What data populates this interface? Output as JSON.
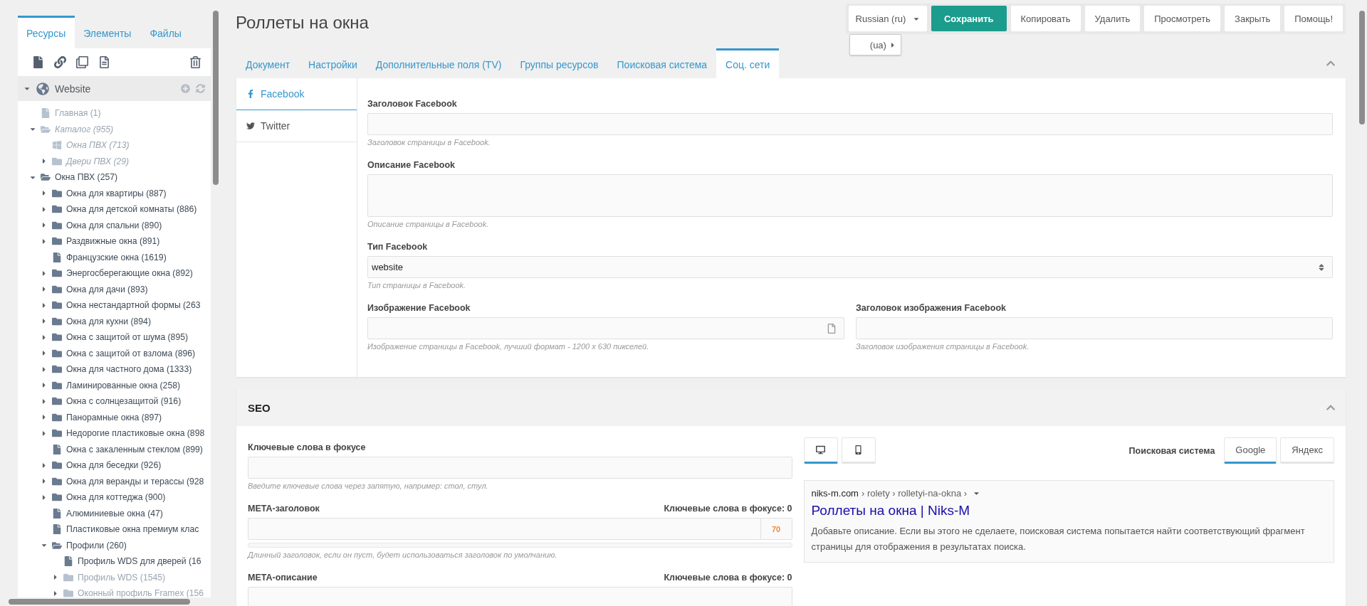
{
  "sidebar": {
    "tabs": [
      {
        "label": "Ресурсы",
        "selected": true
      },
      {
        "label": "Элементы",
        "selected": false
      },
      {
        "label": "Файлы",
        "selected": false
      }
    ],
    "root": {
      "label": "Website",
      "expanded": true
    },
    "tree": [
      {
        "label": "Главная (1)",
        "kind": "file",
        "unpublished": true,
        "hidden": false
      },
      {
        "label": "Каталог (955)",
        "kind": "folder",
        "unpublished": true,
        "hidden": true,
        "expanded": true,
        "children": [
          {
            "label": "Окна ПВХ (713)",
            "kind": "windows",
            "unpublished": true,
            "hidden": true
          },
          {
            "label": "Двери ПВХ (29)",
            "kind": "folder",
            "unpublished": true,
            "hidden": true,
            "expanded": false
          }
        ]
      },
      {
        "label": "Окна ПВХ (257)",
        "kind": "folder",
        "unpublished": false,
        "hidden": false,
        "expanded": true,
        "children": [
          {
            "label": "Окна для квартиры (887)",
            "kind": "folder",
            "expanded": false
          },
          {
            "label": "Окна для детской комнаты (886)",
            "kind": "folder",
            "expanded": false
          },
          {
            "label": "Окна для спальни (890)",
            "kind": "folder",
            "expanded": false
          },
          {
            "label": "Раздвижные окна (891)",
            "kind": "folder",
            "expanded": false
          },
          {
            "label": "Французские окна (1619)",
            "kind": "file"
          },
          {
            "label": "Энергосберегающие окна (892)",
            "kind": "folder",
            "expanded": false
          },
          {
            "label": "Окна для дачи (893)",
            "kind": "folder",
            "expanded": false
          },
          {
            "label": "Окна нестандартной формы (263",
            "kind": "folder",
            "expanded": false
          },
          {
            "label": "Окна для кухни (894)",
            "kind": "folder",
            "expanded": false
          },
          {
            "label": "Окна с защитой от шума (895)",
            "kind": "folder",
            "expanded": false
          },
          {
            "label": "Окна с защитой от взлома (896)",
            "kind": "folder",
            "expanded": false
          },
          {
            "label": "Окна для частного дома (1333)",
            "kind": "folder",
            "expanded": false
          },
          {
            "label": "Ламинированные окна (258)",
            "kind": "folder",
            "expanded": false
          },
          {
            "label": "Окна с солнцезащитой (916)",
            "kind": "folder",
            "expanded": false
          },
          {
            "label": "Панорамные окна (897)",
            "kind": "folder",
            "expanded": false
          },
          {
            "label": "Недорогие пластиковые окна (898",
            "kind": "folder",
            "expanded": false
          },
          {
            "label": "Окна с закаленным стеклом (899)",
            "kind": "file"
          },
          {
            "label": "Окна для беседки (926)",
            "kind": "folder",
            "expanded": false
          },
          {
            "label": "Окна для веранды и терассы (928",
            "kind": "folder",
            "expanded": false
          },
          {
            "label": "Окна для коттеджа (900)",
            "kind": "folder",
            "expanded": false
          },
          {
            "label": "Алюминиевые окна (47)",
            "kind": "file"
          },
          {
            "label": "Пластиковые окна премиум клас",
            "kind": "file"
          },
          {
            "label": "Профили (260)",
            "kind": "folder",
            "expanded": true,
            "children": [
              {
                "label": "Профиль WDS для дверей (16",
                "kind": "file"
              },
              {
                "label": "Профиль WDS (1545)",
                "kind": "folder",
                "unpublished": true,
                "expanded": false
              },
              {
                "label": "Оконный профиль Framex (156",
                "kind": "folder",
                "unpublished": true,
                "expanded": false
              }
            ]
          }
        ]
      }
    ]
  },
  "page": {
    "title": "Роллеты на окна"
  },
  "language": {
    "label": "Russian (ru)",
    "submenu": "(ua)"
  },
  "buttons": [
    {
      "label": "Сохранить",
      "kind": "primary"
    },
    {
      "label": "Копировать",
      "kind": "default"
    },
    {
      "label": "Удалить",
      "kind": "default"
    },
    {
      "label": "Просмотреть",
      "kind": "default"
    },
    {
      "label": "Закрыть",
      "kind": "default"
    },
    {
      "label": "Помощь!",
      "kind": "default"
    }
  ],
  "tabs": [
    {
      "label": "Документ",
      "selected": false
    },
    {
      "label": "Настройки",
      "selected": false
    },
    {
      "label": "Дополнительные поля (TV)",
      "selected": false
    },
    {
      "label": "Группы ресурсов",
      "selected": false
    },
    {
      "label": "Поисковая система",
      "selected": false
    },
    {
      "label": "Соц. сети",
      "selected": true
    }
  ],
  "social": {
    "nav": [
      {
        "label": "Facebook",
        "kind": "facebook",
        "selected": true
      },
      {
        "label": "Twitter",
        "kind": "twitter",
        "selected": false
      }
    ],
    "rows": [
      {
        "fields": [
          {
            "label": "Заголовок Facebook",
            "kind": "text",
            "help": "Заголовок страницы в Facebook."
          }
        ]
      },
      {
        "fields": [
          {
            "label": "Описание Facebook",
            "kind": "textarea",
            "help": "Описание страницы в Facebook."
          }
        ]
      },
      {
        "fields": [
          {
            "label": "Тип Facebook",
            "kind": "select",
            "value": "website",
            "help": "Тип страницы в Facebook."
          }
        ]
      },
      {
        "fields": [
          {
            "label": "Изображение Facebook",
            "kind": "file",
            "help": "Изображение страницы в Facebook, лучший формат - 1200 x 630 пикселей."
          },
          {
            "label": "Заголовок изображения Facebook",
            "kind": "text",
            "help": "Заголовок изображения страницы в Facebook."
          }
        ]
      }
    ]
  },
  "seo": {
    "title": "SEO",
    "expanded": true,
    "fields": [
      {
        "label": "Ключевые слова в фокусе",
        "help": "Введите ключевые слова через запятую, например: стол, стул."
      },
      {
        "label": "META-заголовок",
        "counter": "Ключевые слова в фокусе: 0",
        "count": "70",
        "level": 0,
        "help": "Длинный заголовок, если он пуст, будет использоваться заголовок по умолчанию."
      },
      {
        "label": "META-описание",
        "counter": "Ключевые слова в фокусе: 0"
      }
    ],
    "devices": [
      {
        "kind": "desktop",
        "selected": true
      },
      {
        "kind": "mobile",
        "selected": false
      }
    ],
    "engine_label": "Поисковая система",
    "engines": [
      {
        "label": "Google",
        "selected": true
      },
      {
        "label": "Яндекс",
        "selected": false
      }
    ],
    "snippet": {
      "domain": "niks-m.com",
      "path": "› rolety › rolletyi-na-okna ›",
      "title": "Роллеты на окна | Niks-M",
      "description": "Добавьте описание. Если вы этого не сделаете, поисковая система попытается найти соответствующий фрагмент страницы для отображения в результатах поиска."
    }
  }
}
